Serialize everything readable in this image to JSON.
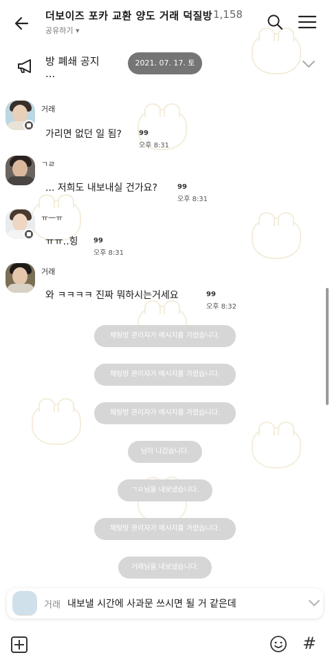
{
  "header": {
    "title": "더보이즈 포카 교환 양도 거래 덕질방",
    "member_count": "1,158",
    "share_label": "공유하기 ▾"
  },
  "notice": {
    "title": "방 폐쇄 공지",
    "more": "...",
    "date": "2021. 07. 17. 토"
  },
  "messages": [
    {
      "sender": "거래",
      "text": "가리면 없던 일 됨?",
      "reaction": "99",
      "time": "오후 8:31"
    },
    {
      "sender": "ㄱㄹ",
      "text": "... 저희도 내보내실 건가요?",
      "reaction": "99",
      "time": "오후 8:31"
    },
    {
      "sender": "ㅠ一ㅠ",
      "text": "ㅠㅠ..힝",
      "reaction": "99",
      "time": "오후 8:31"
    },
    {
      "sender": "거래",
      "text": "와 ㅋㅋㅋㅋ 진짜 뭐하시는거세요",
      "reaction": "99",
      "time": "오후 8:32"
    }
  ],
  "system_messages": [
    "채팅방 관리자가 메시지를 가렸습니다.",
    "채팅방 관리자가 메시지를 가렸습니다.",
    "채팅방 관리자가 메시지를 가렸습니다.",
    "님이 나갔습니다.",
    "ㄱㄹ님을 내보냈습니다.",
    "채팅방 관리자가 메시지를 가렸습니다.",
    "거래님을 내보냈습니다."
  ],
  "preview": {
    "sender": "거래",
    "text": "내보낼 시간에 사과문 쓰시면 될 거 같은데"
  },
  "input_bar": {
    "hash_label": "#"
  },
  "colors": {
    "date_pill": "#757575",
    "system_pill": "#d6d6d6"
  }
}
